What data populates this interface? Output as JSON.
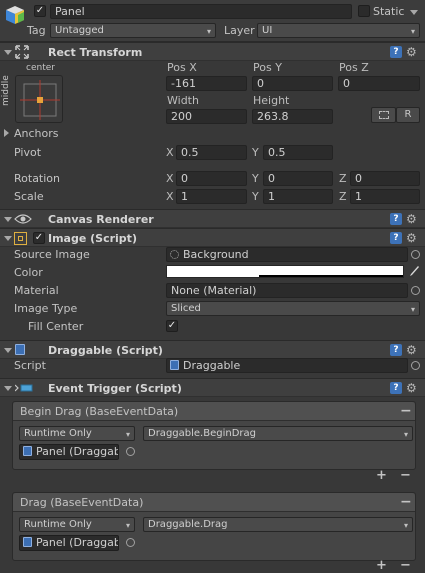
{
  "gameobject": {
    "name": "Panel",
    "active_checked": true,
    "static_label": "Static",
    "static_checked": false,
    "tag_label": "Tag",
    "tag_value": "Untagged",
    "layer_label": "Layer",
    "layer_value": "UI"
  },
  "rect_transform": {
    "title": "Rect Transform",
    "anchor_h": "center",
    "anchor_v": "middle",
    "pos_x_label": "Pos X",
    "pos_y_label": "Pos Y",
    "pos_z_label": "Pos Z",
    "pos_x": "-161",
    "pos_y": "0",
    "pos_z": "0",
    "width_label": "Width",
    "height_label": "Height",
    "width": "200",
    "height": "263.8",
    "r_button": "R",
    "anchors_label": "Anchors",
    "pivot_label": "Pivot",
    "pivot_x": "0.5",
    "pivot_y": "0.5",
    "rotation_label": "Rotation",
    "rot_x": "0",
    "rot_y": "0",
    "rot_z": "0",
    "scale_label": "Scale",
    "scale_x": "1",
    "scale_y": "1",
    "scale_z": "1",
    "axis_x": "X",
    "axis_y": "Y",
    "axis_z": "Z"
  },
  "canvas_renderer": {
    "title": "Canvas Renderer"
  },
  "image": {
    "title": "Image (Script)",
    "enabled": true,
    "source_image_label": "Source Image",
    "source_image_value": "Background",
    "color_label": "Color",
    "color_value": "#ffffff",
    "material_label": "Material",
    "material_value": "None (Material)",
    "image_type_label": "Image Type",
    "image_type_value": "Sliced",
    "fill_center_label": "Fill Center",
    "fill_center_checked": true
  },
  "draggable": {
    "title": "Draggable (Script)",
    "script_label": "Script",
    "script_value": "Draggable"
  },
  "event_trigger": {
    "title": "Event Trigger (Script)",
    "entries": [
      {
        "header": "Begin Drag (BaseEventData)",
        "mode": "Runtime Only",
        "function": "Draggable.BeginDrag",
        "target": "Panel (Draggabl"
      },
      {
        "header": "Drag (BaseEventData)",
        "mode": "Runtime Only",
        "function": "Draggable.Drag",
        "target": "Panel (Draggabl"
      }
    ],
    "plus": "+",
    "minus": "−"
  },
  "icons": {
    "help": "?",
    "gear": "⚙",
    "check": "✓",
    "dropdown_arrow": "▾"
  },
  "colors": {
    "background": "#383838",
    "header": "#3f3f3f",
    "field": "#2b2b2b",
    "help_blue": "#3d72b8"
  }
}
